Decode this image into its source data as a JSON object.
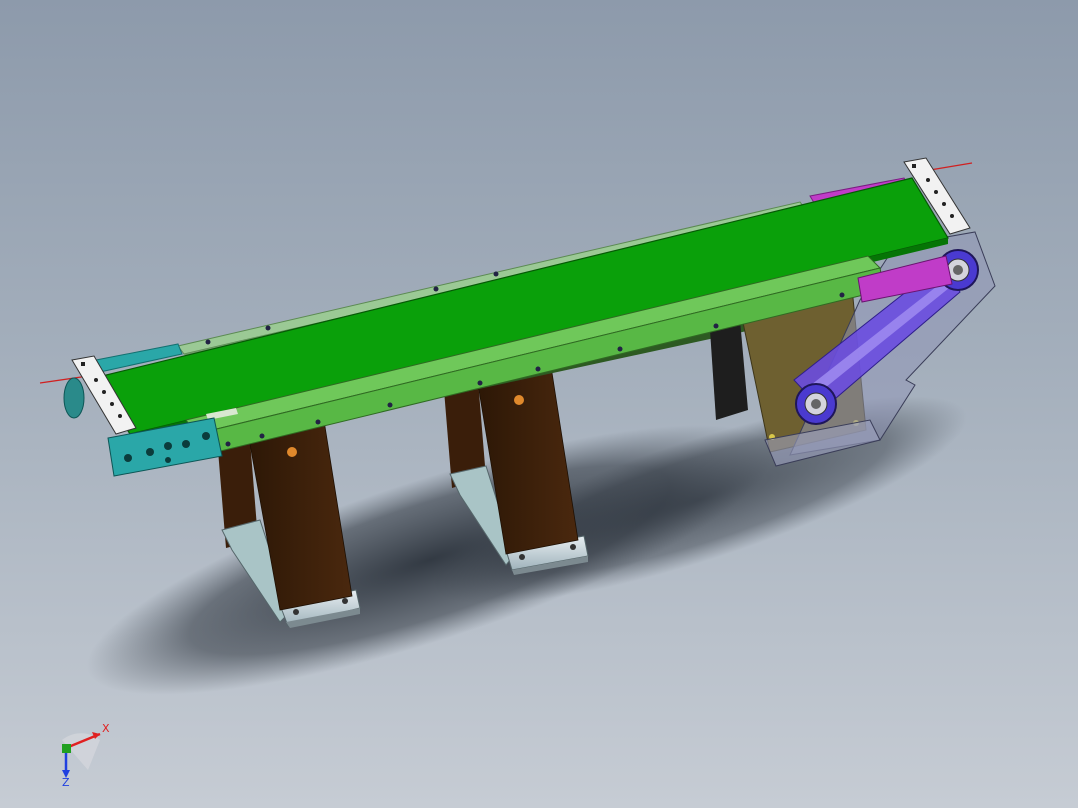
{
  "viewport": {
    "background_top": "#8d9aab",
    "background_bottom": "#c6ccd4"
  },
  "colors": {
    "belt": "#0aa00a",
    "frame": "#6fc85a",
    "frame_far": "#9bc995",
    "legs": "#3a1e0a",
    "motor_plate": "#6e6030",
    "timing_belt": "#6a4ce0",
    "end_cap_left": "#2aa7a8",
    "end_cap_right": "#c03cc8",
    "axis_line": "#d02020"
  },
  "triad": {
    "x_label": "X",
    "z_label": "Z",
    "x_color": "#e02020",
    "y_color": "#20a020",
    "z_color": "#2040e0"
  }
}
